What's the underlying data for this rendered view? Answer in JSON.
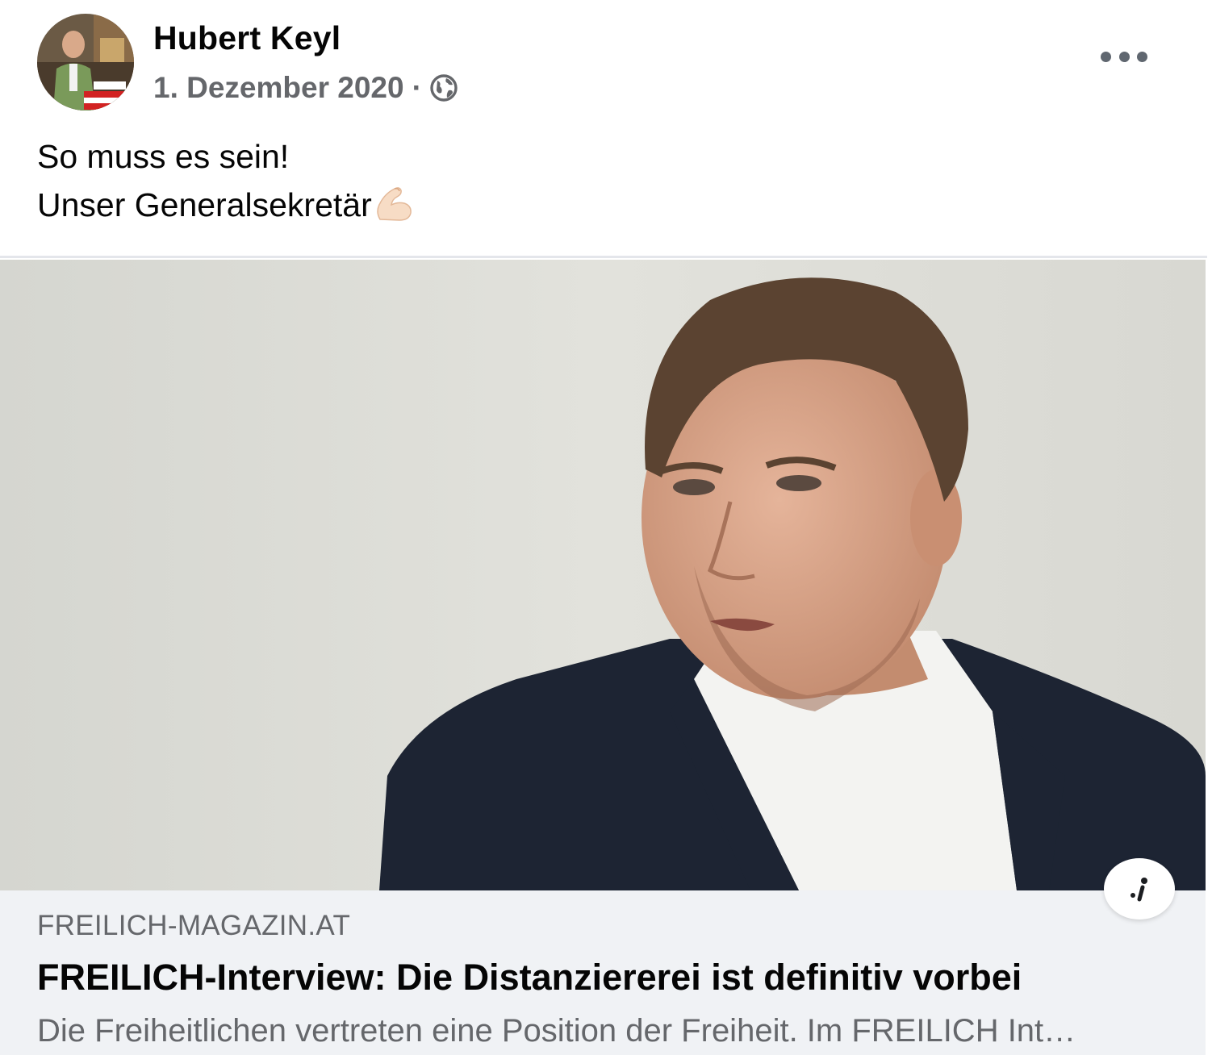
{
  "post": {
    "author": "Hubert Keyl",
    "date": "1. Dezember 2020",
    "separator": "·",
    "privacy_icon": "globe-icon",
    "more_icon": "more-options-icon",
    "text_lines": [
      "So muss es sein!",
      "Unser Generalsekretär"
    ],
    "text_emoji": "flexed-biceps-emoji"
  },
  "link_preview": {
    "domain": "FREILICH-MAGAZIN.AT",
    "title": "FREILICH-Interview: Die Distanziererei ist definitiv vorbei",
    "description": "Die Freiheitlichen vertreten eine Position der Freiheit. Im FREILICH Int…",
    "info_icon": "info-icon"
  },
  "colors": {
    "text_primary": "#050505",
    "text_secondary": "#65676b",
    "footer_background": "#f0f2f5",
    "divider": "#e4e6eb"
  }
}
